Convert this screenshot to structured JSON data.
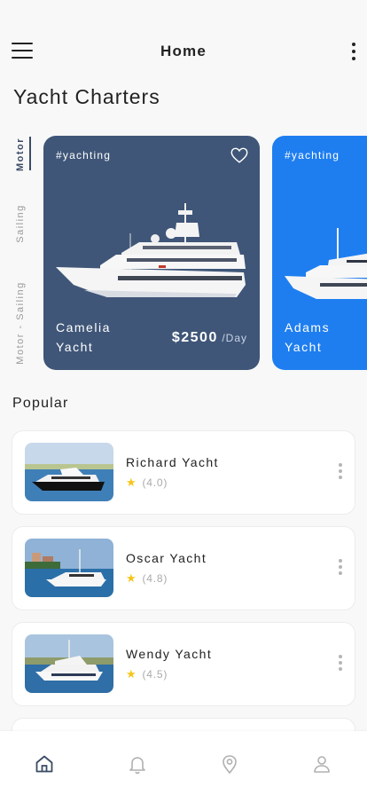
{
  "header": {
    "title": "Home",
    "menu_icon": "hamburger-menu-icon",
    "more_icon": "more-vertical-icon"
  },
  "page_title": "Yacht Charters",
  "categories": [
    {
      "label": "Motor",
      "active": true
    },
    {
      "label": "Sailing",
      "active": false
    },
    {
      "label": "Motor - Sailing",
      "active": false
    }
  ],
  "featured": [
    {
      "tag": "#yachting",
      "name_line1": "Camelia",
      "name_line2": "Yacht",
      "price": "$2500",
      "unit": "/Day",
      "color": "#3f5678",
      "favorite_icon": "heart-outline-icon"
    },
    {
      "tag": "#yachting",
      "name_line1": "Adams",
      "name_line2": "Yacht",
      "color": "#1e7ef0"
    }
  ],
  "popular": {
    "title": "Popular",
    "items": [
      {
        "name": "Richard Yacht",
        "rating": "(4.0)"
      },
      {
        "name": "Oscar Yacht",
        "rating": "(4.8)"
      },
      {
        "name": "Wendy Yacht",
        "rating": "(4.5)"
      }
    ]
  },
  "bottom_nav": [
    {
      "icon": "home-icon",
      "active": true
    },
    {
      "icon": "bell-icon",
      "active": false
    },
    {
      "icon": "location-pin-icon",
      "active": false
    },
    {
      "icon": "profile-icon",
      "active": false
    }
  ],
  "colors": {
    "accent": "#3a4b66",
    "star": "#f5c518",
    "card_dark": "#3f5678",
    "card_blue": "#1e7ef0"
  }
}
